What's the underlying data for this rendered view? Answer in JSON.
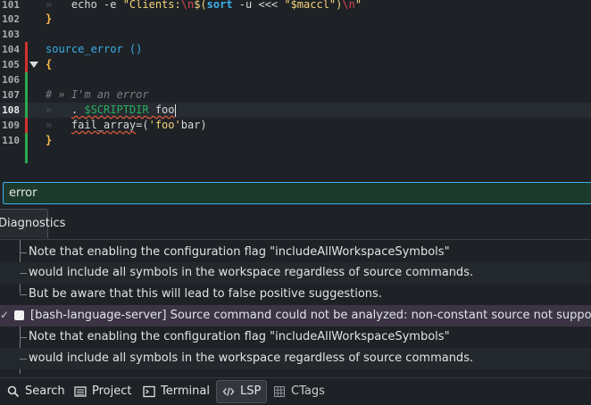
{
  "editor": {
    "lines": [
      {
        "num": "101",
        "tokens": [
          {
            "t": "»   ",
            "c": "tabarrow"
          },
          {
            "t": "echo -e ",
            "c": "plain"
          },
          {
            "t": "\"Clients:",
            "c": "str"
          },
          {
            "t": "\\n",
            "c": "esc"
          },
          {
            "t": "$(",
            "c": "str"
          },
          {
            "t": "sort",
            "c": "fn"
          },
          {
            "t": " -u <<< ",
            "c": "plain"
          },
          {
            "t": "\"$maccl\"",
            "c": "str"
          },
          {
            "t": ")",
            "c": "str"
          },
          {
            "t": "\\n",
            "c": "esc"
          },
          {
            "t": "\"",
            "c": "str"
          }
        ]
      },
      {
        "num": "102",
        "tokens": [
          {
            "t": "}",
            "c": "brace"
          }
        ]
      },
      {
        "num": "103",
        "tokens": []
      },
      {
        "num": "104",
        "tokens": [
          {
            "t": "source_error ()",
            "c": "kw"
          }
        ]
      },
      {
        "num": "105",
        "tokens": [
          {
            "t": "{",
            "c": "brace"
          }
        ]
      },
      {
        "num": "106",
        "tokens": []
      },
      {
        "num": "107",
        "tokens": [
          {
            "t": "# » I'm an error",
            "c": "cmt"
          }
        ]
      },
      {
        "num": "108",
        "tokens": [
          {
            "t": "»   ",
            "c": "tabarrow"
          },
          {
            "t": ". ",
            "c": "plain err"
          },
          {
            "t": "$SCRIPTDIR",
            "c": "var err"
          },
          {
            "t": " foo",
            "c": "plain err"
          }
        ]
      },
      {
        "num": "109",
        "tokens": [
          {
            "t": "»   ",
            "c": "tabarrow"
          },
          {
            "t": "fail_array",
            "c": "plain err"
          },
          {
            "t": "=(",
            "c": "plain"
          },
          {
            "t": "'foo'",
            "c": "str"
          },
          {
            "t": "bar)",
            "c": "plain"
          }
        ]
      },
      {
        "num": "110",
        "tokens": [
          {
            "t": "}",
            "c": "brace"
          }
        ]
      }
    ]
  },
  "filter": {
    "value": "error",
    "placeholder": ""
  },
  "panel": {
    "tab_label": "Diagnostics"
  },
  "diagnostics": {
    "rows": [
      {
        "text": "Note that enabling the configuration flag \"includeAllWorkspaceSymbols\""
      },
      {
        "text": "would include all symbols in the workspace regardless of source commands."
      },
      {
        "text": "But be aware that this will lead to false positive suggestions."
      },
      {
        "text": "[bash-language-server] Source command could not be analyzed: non-constant source not supported."
      },
      {
        "text": "Note that enabling the configuration flag \"includeAllWorkspaceSymbols\""
      },
      {
        "text": "would include all symbols in the workspace regardless of source commands."
      }
    ]
  },
  "toolbar": {
    "search": "Search",
    "project": "Project",
    "terminal": "Terminal",
    "lsp": "LSP",
    "ctags": "CTags"
  },
  "colors": {
    "accent": "#3daee9",
    "error_mark": "#d2322d",
    "modified_mark": "#2fa84f",
    "selection": "#3b3445"
  }
}
